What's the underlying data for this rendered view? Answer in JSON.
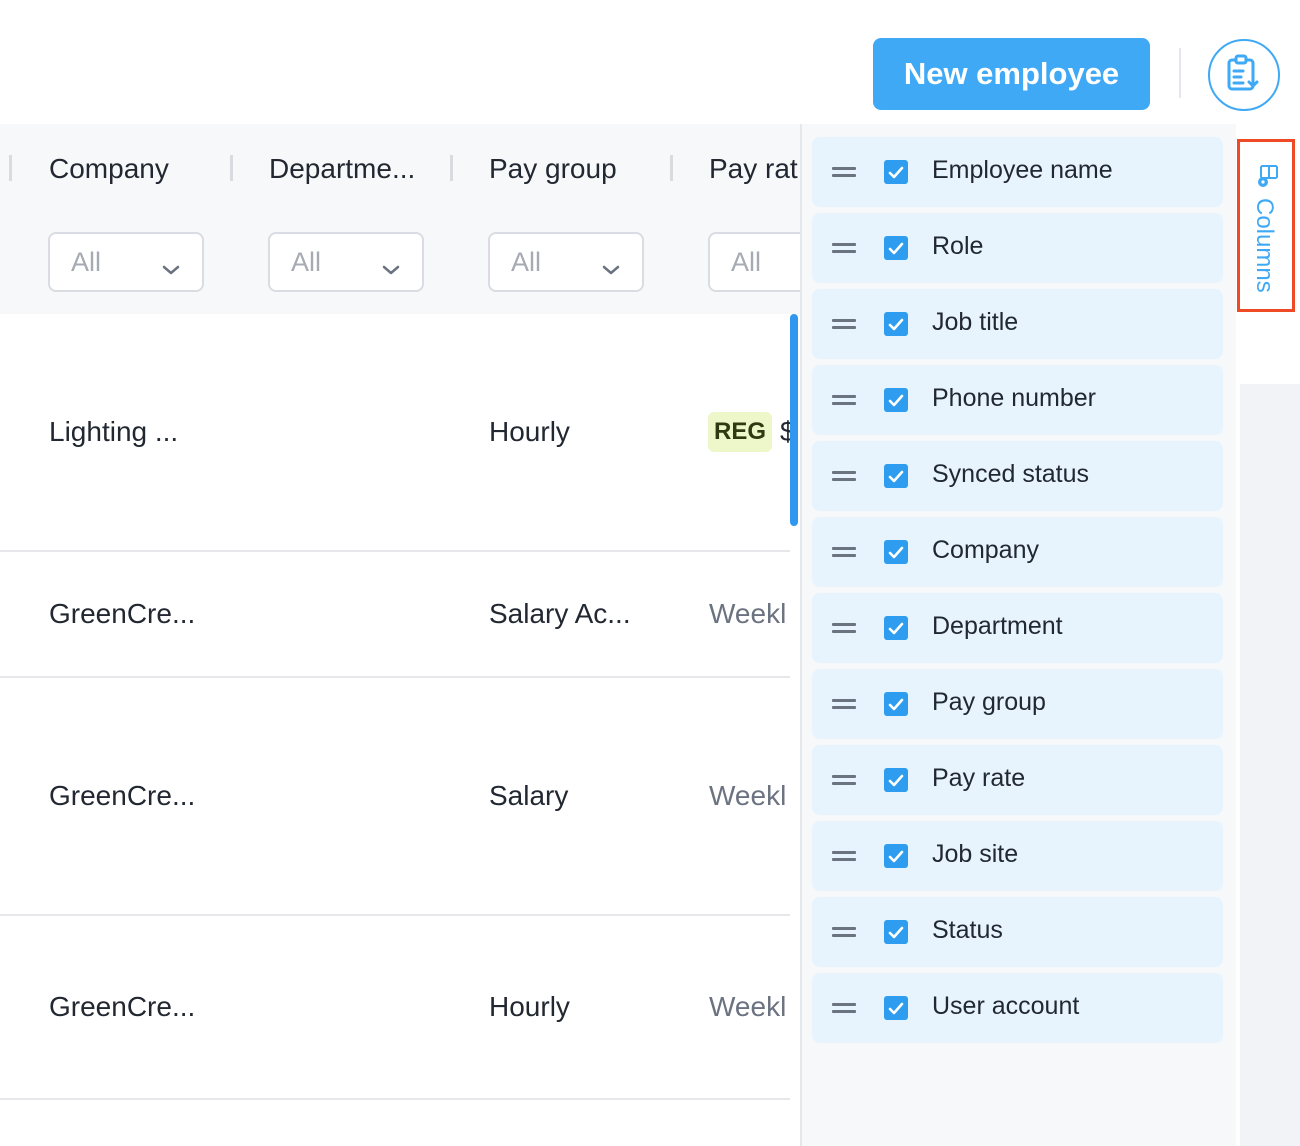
{
  "toolbar": {
    "new_employee_label": "New employee",
    "export_icon": "clipboard-export-icon"
  },
  "table": {
    "columns": [
      {
        "title": "Company",
        "filter": "All"
      },
      {
        "title": "Departme...",
        "filter": "All"
      },
      {
        "title": "Pay group",
        "filter": "All"
      },
      {
        "title": "Pay rat",
        "filter": "All"
      }
    ],
    "rows": [
      {
        "company": "Lighting ...",
        "department": "",
        "pay_group": "Hourly",
        "pay_rate_badge": "REG",
        "pay_rate": "$"
      },
      {
        "company": "GreenCre...",
        "department": "",
        "pay_group": "Salary Ac...",
        "pay_rate": "Weekl"
      },
      {
        "company": "GreenCre...",
        "department": "",
        "pay_group": "Salary",
        "pay_rate": "Weekl"
      },
      {
        "company": "GreenCre...",
        "department": "",
        "pay_group": "Hourly",
        "pay_rate": "Weekl"
      }
    ]
  },
  "column_panel": {
    "tab_label": "Columns",
    "items": [
      {
        "label": "Employee name",
        "checked": true
      },
      {
        "label": "Role",
        "checked": true
      },
      {
        "label": "Job title",
        "checked": true
      },
      {
        "label": "Phone number",
        "checked": true
      },
      {
        "label": "Synced status",
        "checked": true
      },
      {
        "label": "Company",
        "checked": true
      },
      {
        "label": "Department",
        "checked": true
      },
      {
        "label": "Pay group",
        "checked": true
      },
      {
        "label": "Pay rate",
        "checked": true
      },
      {
        "label": "Job site",
        "checked": true
      },
      {
        "label": "Status",
        "checked": true
      },
      {
        "label": "User account",
        "checked": true
      }
    ]
  },
  "colors": {
    "accent": "#3fa9f5",
    "highlight_outline": "#ef4a26",
    "panel_item_bg": "#e7f4fe",
    "badge_bg": "#edf7c9"
  }
}
